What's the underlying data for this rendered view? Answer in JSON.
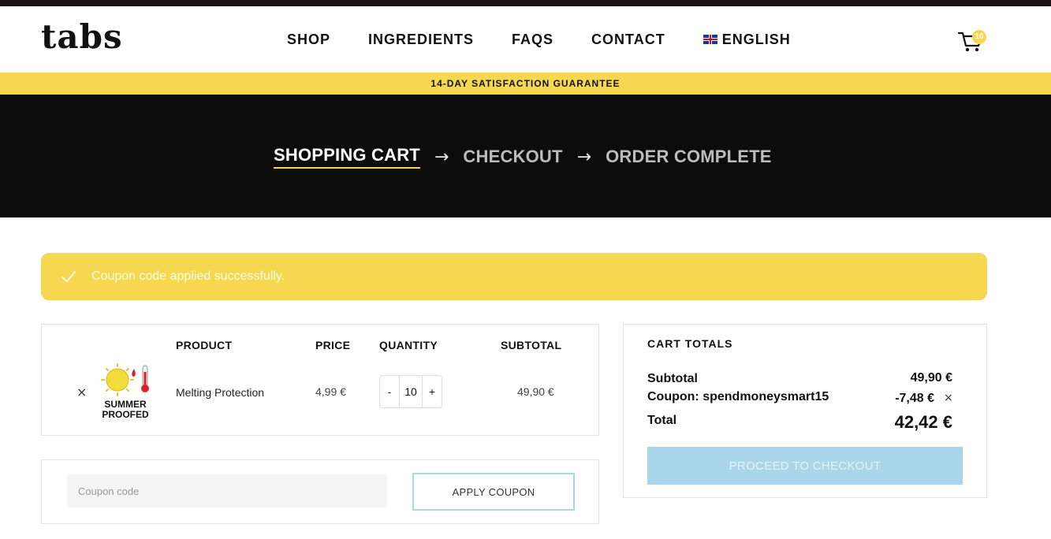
{
  "header": {
    "logo": "tabs",
    "nav": [
      "SHOP",
      "INGREDIENTS",
      "FAQS",
      "CONTACT"
    ],
    "language": "ENGLISH",
    "cart_count": "10"
  },
  "announcement": "14-DAY SATISFACTION GUARANTEE",
  "steps": {
    "cart": "SHOPPING CART",
    "checkout": "CHECKOUT",
    "complete": "ORDER COMPLETE",
    "arrow": "→"
  },
  "notice": "Coupon code applied successfully.",
  "cart": {
    "headers": {
      "product": "PRODUCT",
      "price": "PRICE",
      "quantity": "QUANTITY",
      "subtotal": "SUBTOTAL"
    },
    "item": {
      "remove": "×",
      "image_text_line1": "SUMMER",
      "image_text_line2": "PROOFED",
      "name": "Melting Protection",
      "price": "4,99 €",
      "minus": "-",
      "quantity": "10",
      "plus": "+",
      "subtotal": "49,90 €"
    }
  },
  "coupon": {
    "placeholder": "Coupon code",
    "button": "APPLY COUPON"
  },
  "totals": {
    "title": "CART TOTALS",
    "subtotal_label": "Subtotal",
    "subtotal_value": "49,90 €",
    "coupon_label": "Coupon: spendmoneysmart15",
    "coupon_value": "-7,48 €",
    "coupon_remove": "×",
    "total_label": "Total",
    "total_value": "42,42 €",
    "checkout_button": "PROCEED TO CHECKOUT"
  },
  "colors": {
    "accent_yellow": "#f5d84f",
    "hero_black": "#0c0c0c",
    "checkout_blue": "#a9d6ea"
  }
}
